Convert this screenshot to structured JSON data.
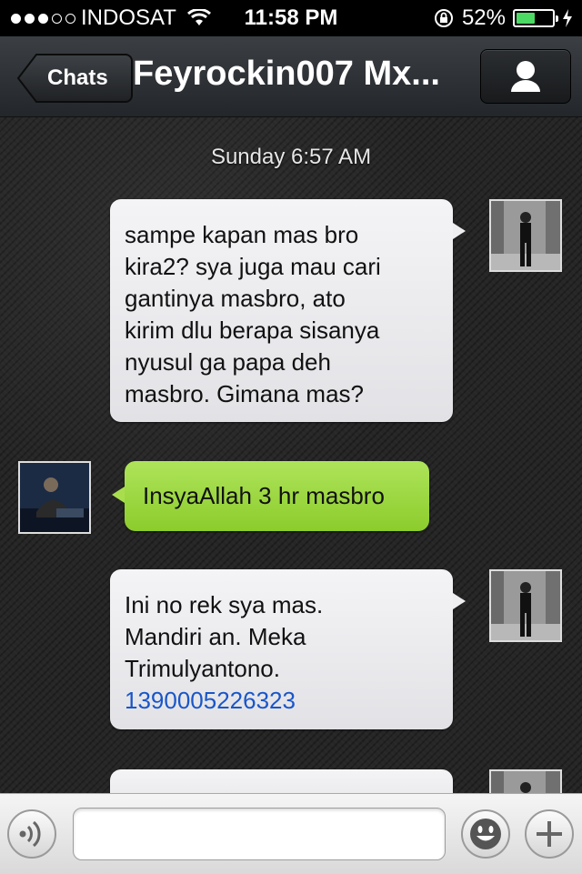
{
  "status_bar": {
    "carrier": "INDOSAT",
    "time": "11:58 PM",
    "battery_percent": "52%",
    "battery_level": 0.52,
    "signal_bars_filled": 3,
    "signal_bars_total": 5
  },
  "nav": {
    "back_label": "Chats",
    "title": "Feyrockin007 Mx..."
  },
  "chat": {
    "timestamp": "Sunday 6:57 AM",
    "messages": [
      {
        "side": "right",
        "lines": [
          "sampe kapan mas bro",
          "kira2? sya juga mau cari",
          "gantinya masbro, ato",
          "kirim dlu berapa sisanya",
          "nyusul ga papa deh",
          "masbro. Gimana mas?"
        ]
      },
      {
        "side": "left",
        "text": "InsyaAllah 3 hr masbro"
      },
      {
        "side": "right",
        "lines": [
          "Ini no rek sya mas.",
          "Mandiri an. Meka",
          "Trimulyantono."
        ],
        "link": "1390005226323"
      }
    ]
  },
  "colors": {
    "green_bubble": "#9ed743",
    "link": "#1a56c8",
    "battery": "#4cd964"
  }
}
